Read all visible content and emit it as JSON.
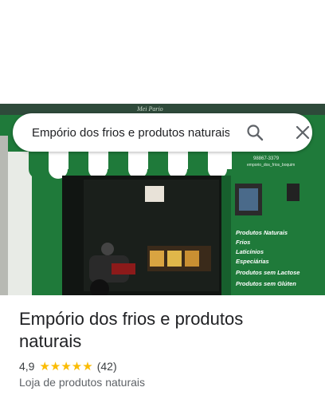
{
  "search": {
    "query": "Empório dos frios e produtos naturais"
  },
  "place": {
    "title": "Empório dos frios e produtos naturais",
    "rating": "4,9",
    "stars": "★★★★★",
    "review_count": "(42)",
    "category": "Loja de produtos naturais"
  },
  "photo": {
    "sign_text": "Mei Pario",
    "phone": "98867-3379",
    "handle": "emporio_dos_frios_boquim",
    "product_list": [
      "Produtos Naturais",
      "Frios",
      "Laticínios",
      "Especiárias",
      "Produtos sem Lactose",
      "Produtos sem Glúten"
    ]
  },
  "icons": {
    "search": "search-icon",
    "close": "close-icon"
  },
  "colors": {
    "storefront_green": "#1f7a3a",
    "star_yellow": "#fbbc04"
  }
}
